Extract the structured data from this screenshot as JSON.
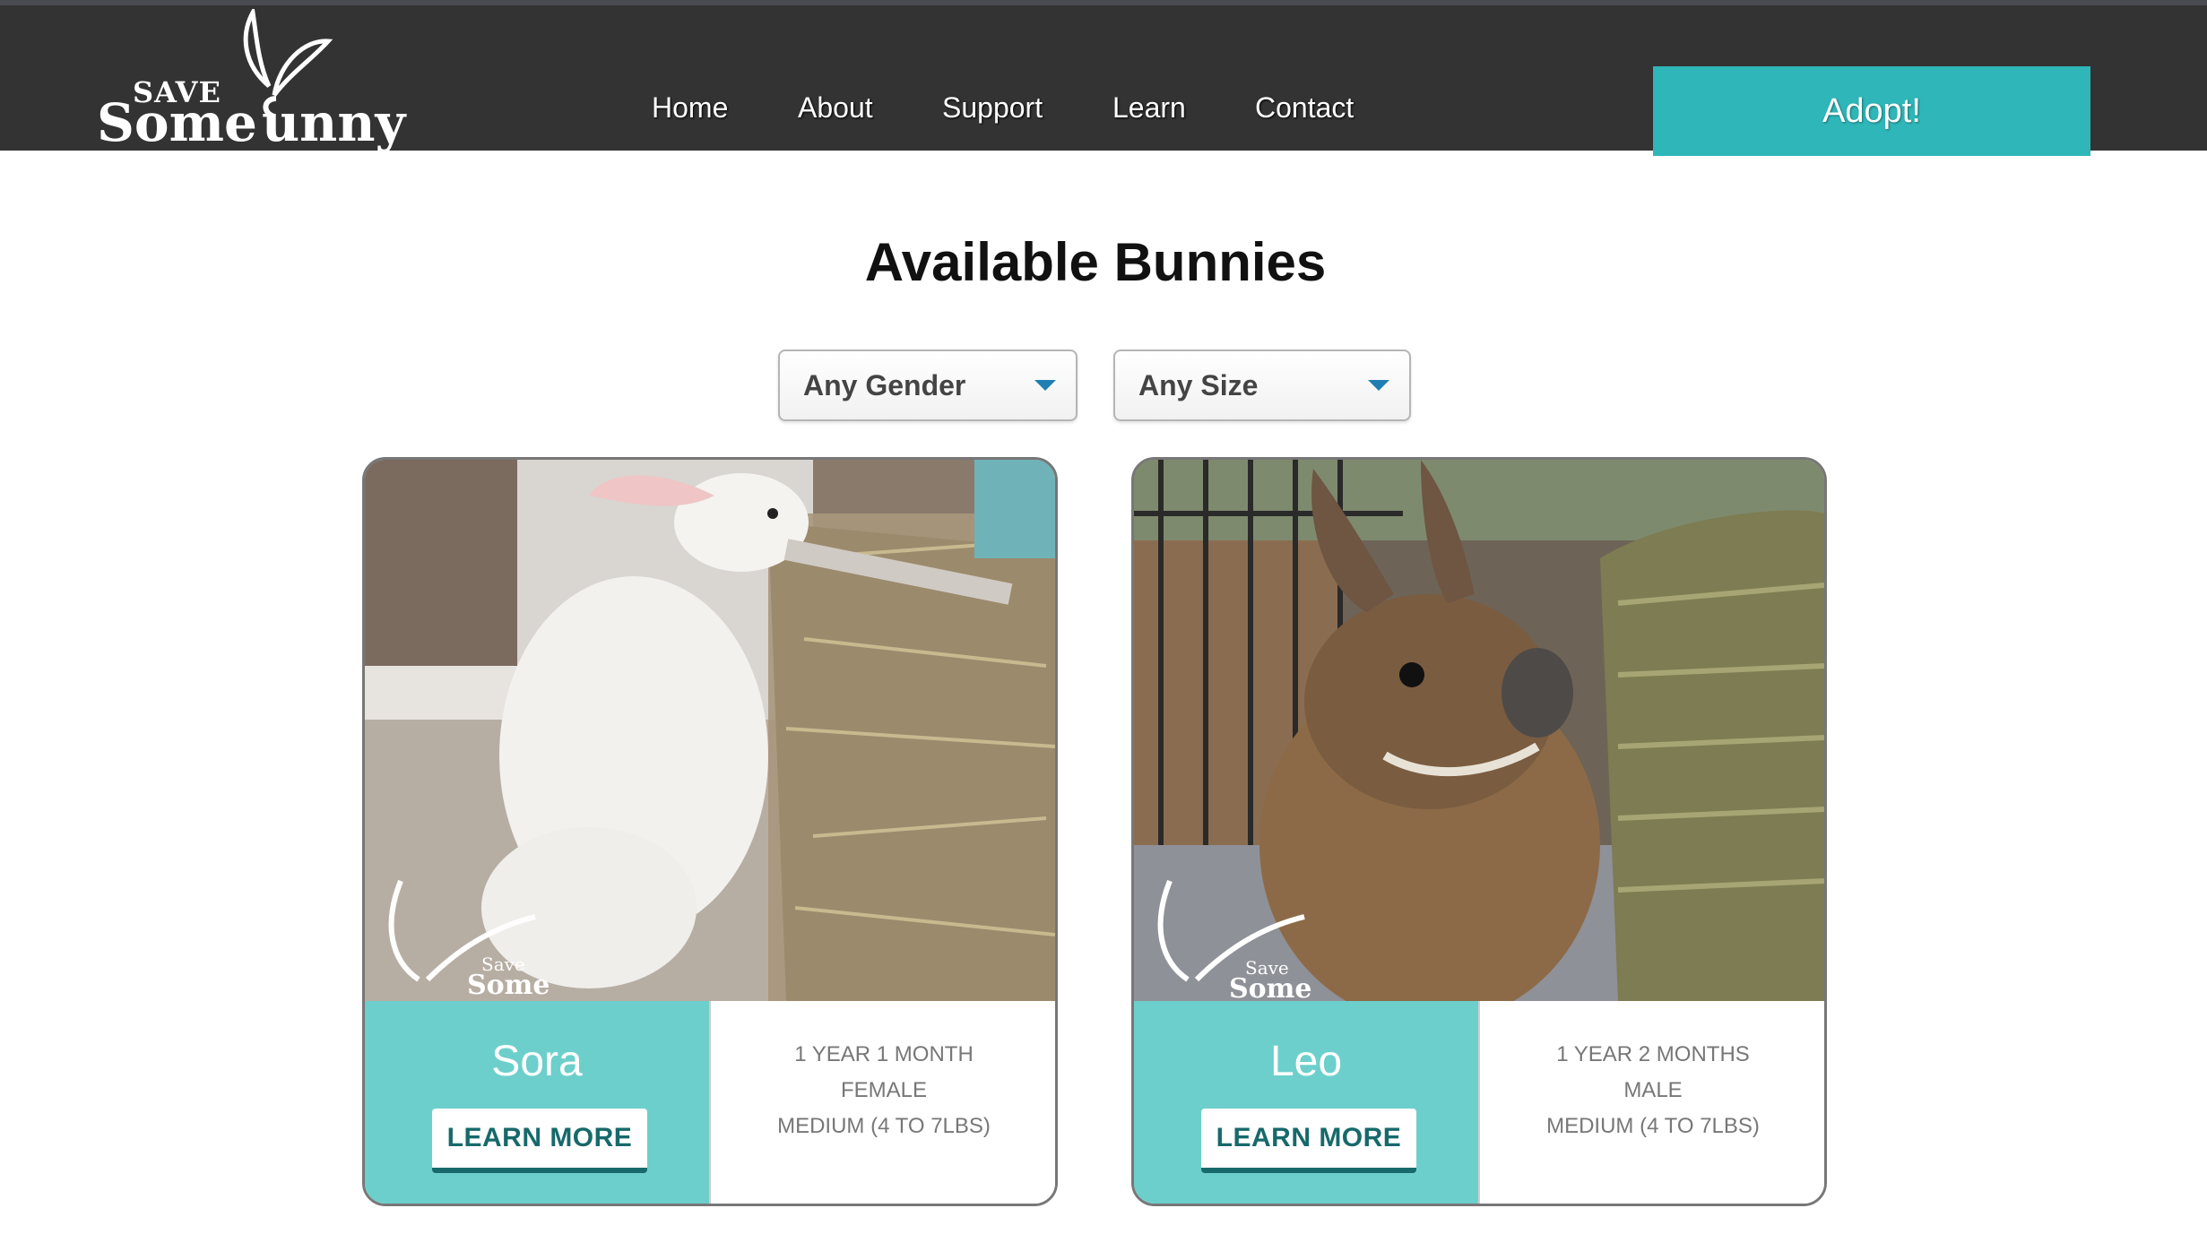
{
  "brand": {
    "save": "SAVE",
    "some": "Some",
    "bunny": "unny"
  },
  "nav": {
    "items": [
      {
        "label": "Home"
      },
      {
        "label": "About"
      },
      {
        "label": "Support"
      },
      {
        "label": "Learn"
      },
      {
        "label": "Contact"
      }
    ],
    "cta": "Adopt!"
  },
  "page": {
    "title": "Available Bunnies"
  },
  "filters": {
    "gender": "Any Gender",
    "size": "Any Size"
  },
  "bunnies": [
    {
      "name": "Sora",
      "age": "1 YEAR 1 MONTH",
      "gender": "FEMALE",
      "size": "MEDIUM (4 TO 7LBS)",
      "button": "LEARN MORE",
      "watermark_save": "Save",
      "watermark_some": "Some"
    },
    {
      "name": "Leo",
      "age": "1 YEAR 2 MONTHS",
      "gender": "MALE",
      "size": "MEDIUM (4 TO 7LBS)",
      "button": "LEARN MORE",
      "watermark_save": "Save",
      "watermark_some": "Some"
    }
  ],
  "colors": {
    "header": "#333333",
    "accent": "#2fb6b8",
    "card_panel": "#6dcfcb",
    "button_text": "#17696b"
  }
}
